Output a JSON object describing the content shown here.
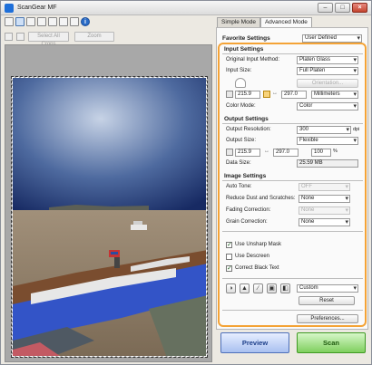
{
  "window": {
    "title": "ScanGear MF"
  },
  "tabs": [
    {
      "label": "Simple Mode"
    },
    {
      "label": "Advanced Mode"
    }
  ],
  "favorite": {
    "label": "Favorite Settings",
    "value": "User Defined"
  },
  "toolbar": {
    "select_all_label": "Select All Crops",
    "zoom_label": "Zoom",
    "info_glyph": "i"
  },
  "input_settings": {
    "title": "Input Settings",
    "method_label": "Original Input Method:",
    "method_value": "Platen Glass",
    "size_label": "Input Size:",
    "size_value": "Full Platen",
    "orientation_label": "Orientation...",
    "width_value": "215.9",
    "height_value": "297.0",
    "unit_value": "Millimeters",
    "color_label": "Color Mode:",
    "color_value": "Color"
  },
  "output_settings": {
    "title": "Output Settings",
    "resolution_label": "Output Resolution:",
    "resolution_value": "300",
    "resolution_unit": "dpi",
    "size_label": "Output Size:",
    "size_value": "Flexible",
    "width_value": "215.9",
    "height_value": "297.0",
    "scale_value": "100",
    "scale_unit": "%",
    "data_size_label": "Data Size:",
    "data_size_value": "25.59 MB"
  },
  "image_settings": {
    "title": "Image Settings",
    "auto_tone_label": "Auto Tone:",
    "auto_tone_value": "OFF",
    "dust_label": "Reduce Dust and Scratches:",
    "dust_value": "None",
    "fading_label": "Fading Correction:",
    "fading_value": "None",
    "grain_label": "Grain Correction:",
    "grain_value": "None",
    "unsharp_label": "Use Unsharp Mask",
    "unsharp_checked": true,
    "descreen_label": "Use Descreen",
    "descreen_checked": false,
    "black_text_label": "Correct Black Text",
    "black_text_checked": true
  },
  "adjust": {
    "preset_value": "Custom",
    "reset_label": "Reset"
  },
  "preferences_label": "Preferences...",
  "actions": {
    "preview_label": "Preview",
    "scan_label": "Scan"
  }
}
